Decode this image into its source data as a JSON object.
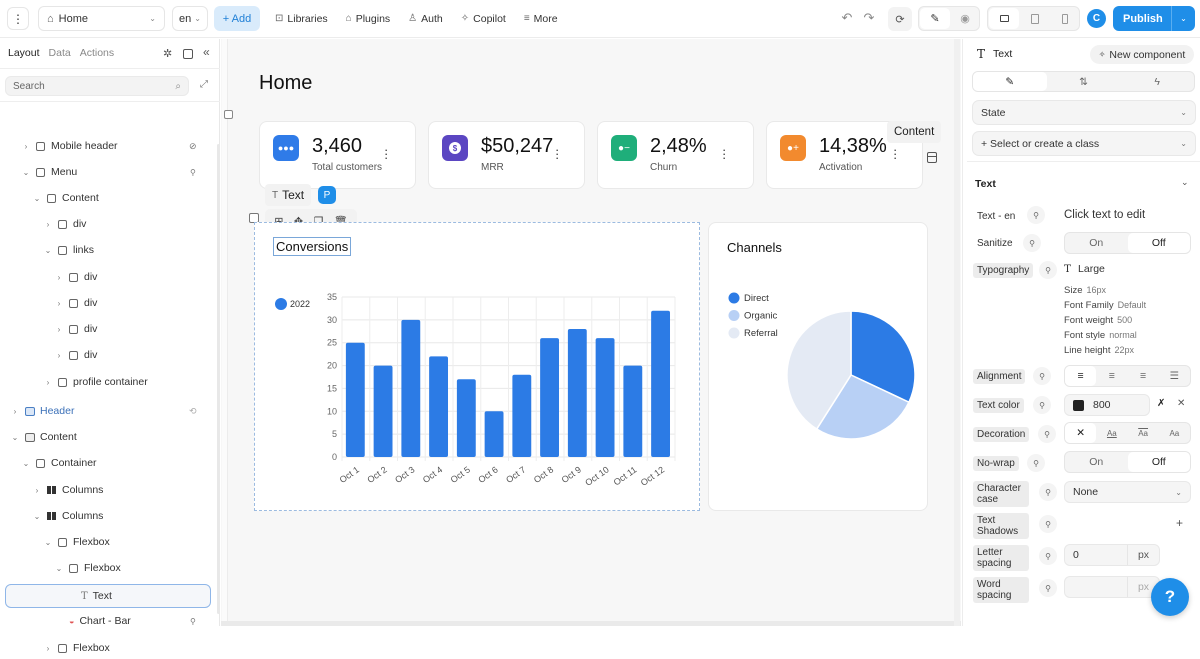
{
  "topbar": {
    "page_select": "Home",
    "lang_select": "en",
    "add_label": "+ Add",
    "nav": [
      {
        "icon": "book-icon",
        "glyph": "⊡",
        "label": "Libraries"
      },
      {
        "icon": "plug-icon",
        "glyph": "⌂",
        "label": "Plugins"
      },
      {
        "icon": "user-lock-icon",
        "glyph": "♙",
        "label": "Auth"
      },
      {
        "icon": "sparkle-icon",
        "glyph": "✧",
        "label": "Copilot"
      },
      {
        "icon": "menu-icon",
        "glyph": "≡",
        "label": "More"
      }
    ],
    "avatar_initial": "C",
    "publish_label": "Publish"
  },
  "left_panel": {
    "tabs": [
      "Layout",
      "Data",
      "Actions"
    ],
    "search_placeholder": "Search",
    "tree": [
      {
        "label": "Mobile header",
        "depth": 1,
        "chev": "›",
        "icon": "box",
        "badge": "eye-off"
      },
      {
        "label": "Menu",
        "depth": 1,
        "chev": "⌄",
        "icon": "box",
        "badge": "link"
      },
      {
        "label": "Content",
        "depth": 2,
        "chev": "⌄",
        "icon": "box"
      },
      {
        "label": "div",
        "depth": 3,
        "chev": "›",
        "icon": "box"
      },
      {
        "label": "links",
        "depth": 3,
        "chev": "⌄",
        "icon": "box"
      },
      {
        "label": "div",
        "depth": 4,
        "chev": "›",
        "icon": "box"
      },
      {
        "label": "div",
        "depth": 4,
        "chev": "›",
        "icon": "box"
      },
      {
        "label": "div",
        "depth": 4,
        "chev": "›",
        "icon": "box"
      },
      {
        "label": "div",
        "depth": 4,
        "chev": "›",
        "icon": "box"
      },
      {
        "label": "profile container",
        "depth": 3,
        "chev": "›",
        "icon": "box"
      },
      {
        "label": "Header",
        "depth": 0,
        "chev": "›",
        "icon": "section",
        "badge": "link2",
        "accent": true
      },
      {
        "label": "Content",
        "depth": 0,
        "chev": "⌄",
        "icon": "section"
      },
      {
        "label": "Container",
        "depth": 1,
        "chev": "⌄",
        "icon": "box"
      },
      {
        "label": "Columns",
        "depth": 2,
        "chev": "›",
        "icon": "columns"
      },
      {
        "label": "Columns",
        "depth": 2,
        "chev": "⌄",
        "icon": "columns"
      },
      {
        "label": "Flexbox",
        "depth": 3,
        "chev": "⌄",
        "icon": "box"
      },
      {
        "label": "Flexbox",
        "depth": 4,
        "chev": "⌄",
        "icon": "box"
      },
      {
        "label": "Text",
        "depth": 5,
        "chev": "",
        "icon": "text",
        "selected": true
      },
      {
        "label": "Chart - Bar",
        "depth": 4,
        "chev": "",
        "icon": "chart",
        "badge": "link"
      },
      {
        "label": "Flexbox",
        "depth": 3,
        "chev": "›",
        "icon": "box"
      }
    ]
  },
  "canvas": {
    "page_title": "Home",
    "kpis": [
      {
        "value": "3,460",
        "label": "Total customers",
        "color": "#2f7be8",
        "icon": "users-icon"
      },
      {
        "value": "$50,247",
        "label": "MRR",
        "color": "#5b46c2",
        "icon": "dollar-icon"
      },
      {
        "value": "2,48%",
        "label": "Churn",
        "color": "#1fae7a",
        "icon": "user-minus-icon"
      },
      {
        "value": "14,38%",
        "label": "Activation",
        "color": "#f28a2e",
        "icon": "user-plus-icon"
      }
    ],
    "content_tag": "Content",
    "selection_tag": "Text",
    "selection_badge": "P",
    "conversions_title": "Conversions",
    "channels_title": "Channels"
  },
  "chart_data": [
    {
      "type": "bar",
      "title": "Conversions",
      "categories": [
        "Oct 1",
        "Oct 2",
        "Oct 3",
        "Oct 4",
        "Oct 5",
        "Oct 6",
        "Oct 7",
        "Oct 8",
        "Oct 9",
        "Oct 10",
        "Oct 11",
        "Oct 12"
      ],
      "series": [
        {
          "name": "2022",
          "values": [
            25,
            20,
            30,
            22,
            17,
            10,
            18,
            26,
            28,
            26,
            20,
            32
          ],
          "color": "#2c7be5"
        }
      ],
      "yticks": [
        0,
        5,
        10,
        15,
        20,
        25,
        30,
        35
      ],
      "ylim": [
        0,
        35
      ],
      "grid": true,
      "legend": "top-left"
    },
    {
      "type": "pie",
      "title": "Channels",
      "labels": [
        "Direct",
        "Organic",
        "Referral"
      ],
      "values": [
        32,
        27,
        41
      ],
      "colors": [
        "#2c7be5",
        "#b8d0f5",
        "#e4eaf4"
      ],
      "legend": "top-left"
    }
  ],
  "right_panel": {
    "element_type": "Text",
    "new_component_label": "New component",
    "state_label": "State",
    "class_label": "+ Select or create a class",
    "section_title": "Text",
    "text_label": "Text - en",
    "text_value": "Click text to edit",
    "sanitize_label": "Sanitize",
    "on_label": "On",
    "off_label": "Off",
    "typography_label": "Typography",
    "typography_preset": "Large",
    "typography": [
      {
        "k": "Size",
        "v": "16px"
      },
      {
        "k": "Font Family",
        "v": "Default"
      },
      {
        "k": "Font weight",
        "v": "500"
      },
      {
        "k": "Font style",
        "v": "normal"
      },
      {
        "k": "Line height",
        "v": "22px"
      }
    ],
    "alignment_label": "Alignment",
    "text_color_label": "Text color",
    "text_color_value": "800",
    "decoration_label": "Decoration",
    "decoration_options": [
      "✕",
      "Aa",
      "Aa",
      "Aa"
    ],
    "nowrap_label": "No-wrap",
    "char_case_label": "Character case",
    "char_case_value": "None",
    "shadows_label": "Text Shadows",
    "letter_spacing_label": "Letter spacing",
    "letter_spacing_value": "0",
    "word_spacing_label": "Word spacing",
    "word_spacing_value": "",
    "unit": "px"
  }
}
